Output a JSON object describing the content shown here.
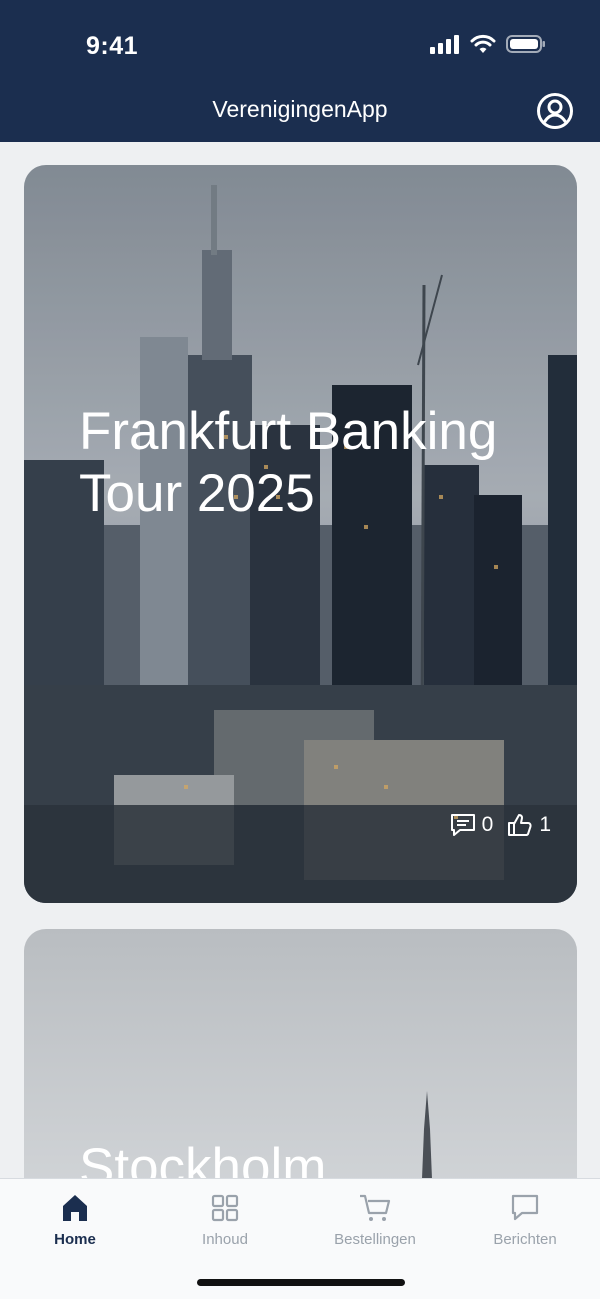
{
  "status_bar": {
    "time": "9:41"
  },
  "header": {
    "title": "VerenigingenApp"
  },
  "cards": [
    {
      "title": "Frankfurt Banking Tour 2025",
      "comments": "0",
      "likes": "1"
    },
    {
      "title": "Stockholm"
    }
  ],
  "bottom_nav": {
    "items": [
      {
        "label": "Home",
        "icon": "home-icon",
        "active": true
      },
      {
        "label": "Inhoud",
        "icon": "grid-icon",
        "active": false
      },
      {
        "label": "Bestellingen",
        "icon": "cart-icon",
        "active": false
      },
      {
        "label": "Berichten",
        "icon": "message-icon",
        "active": false
      }
    ]
  },
  "colors": {
    "header": "#1b2e4f",
    "background": "#eef0f2",
    "nav_active": "#1b2e4f",
    "nav_inactive": "#9aa2ab"
  }
}
